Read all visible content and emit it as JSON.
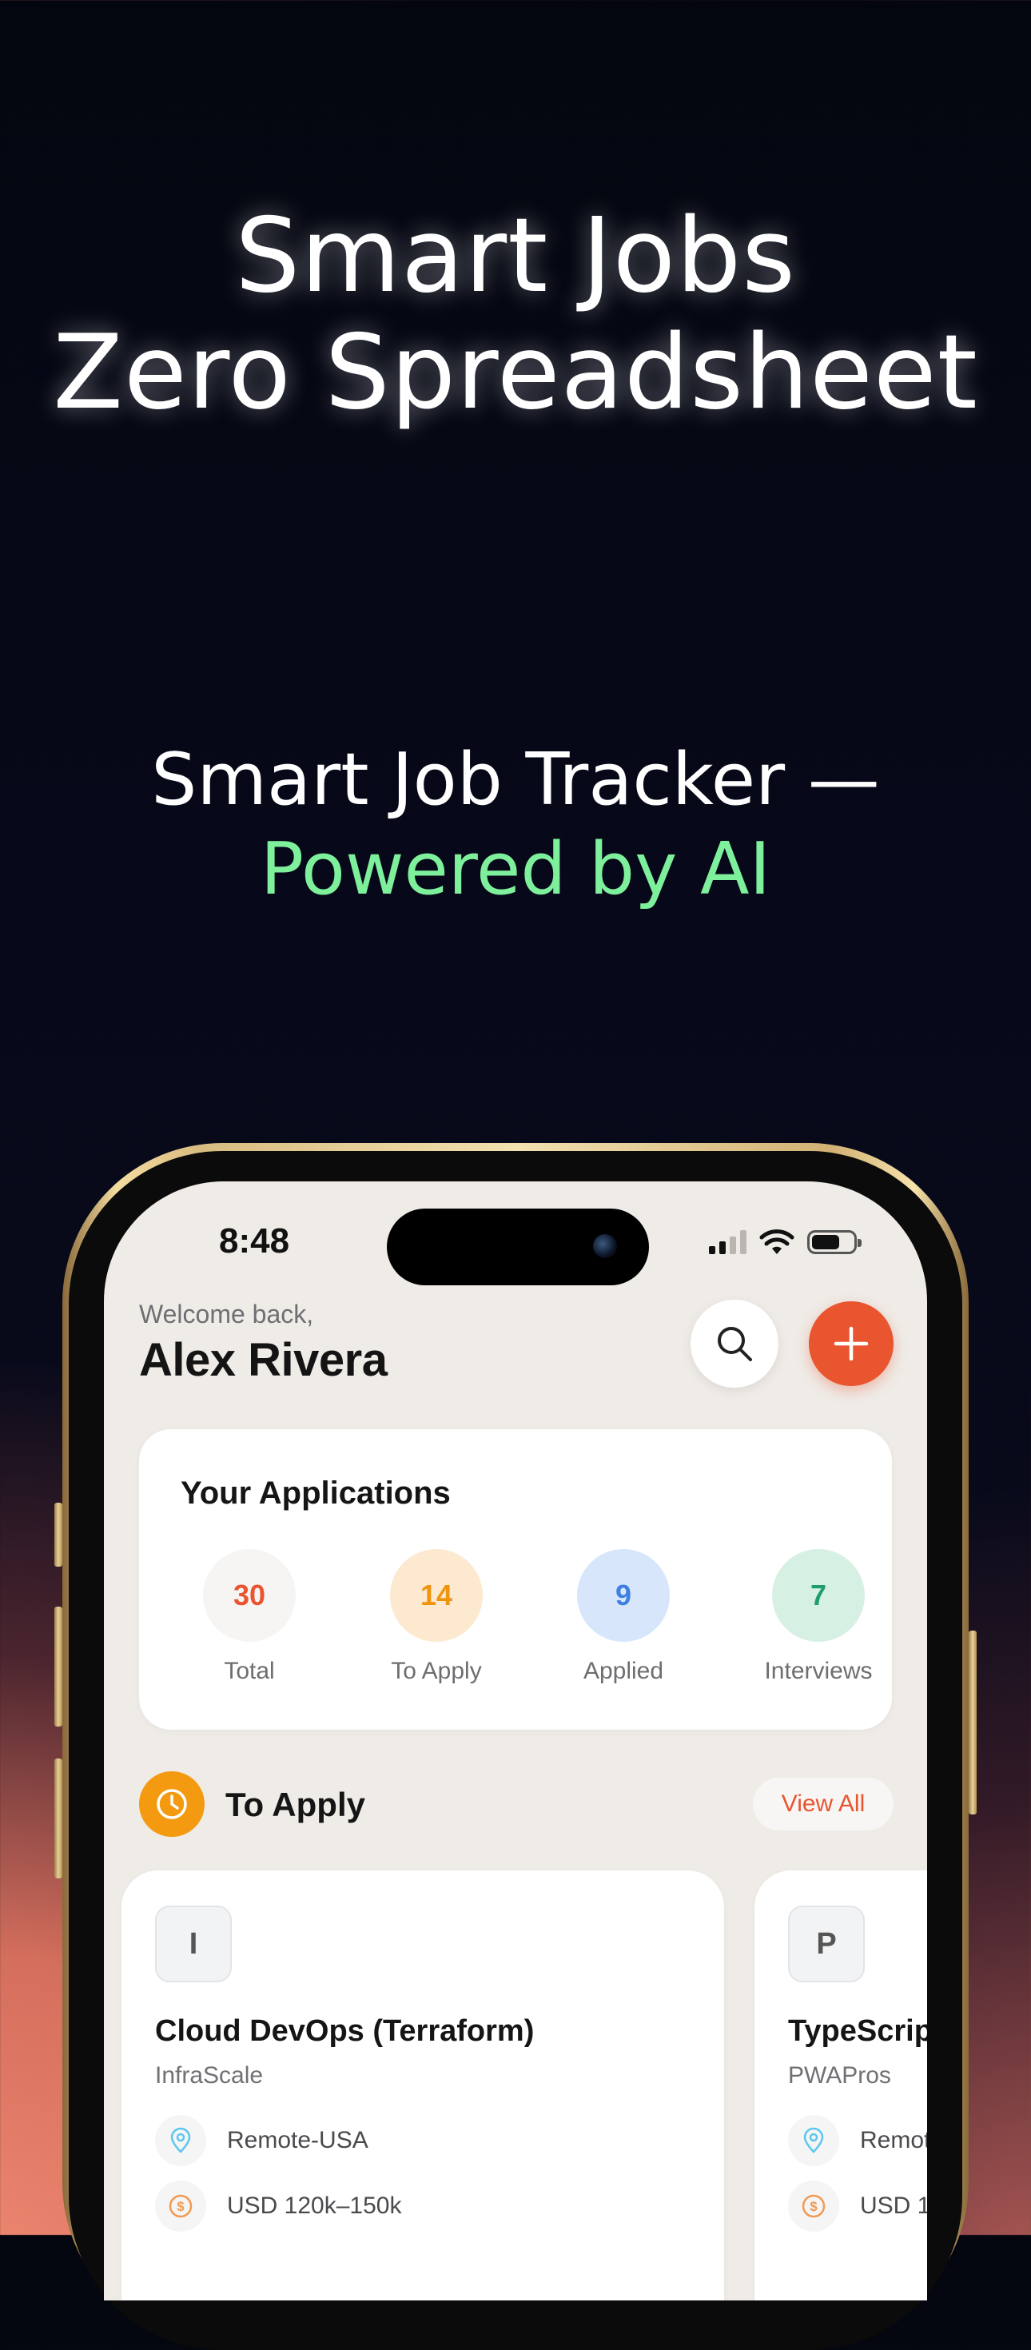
{
  "hero": {
    "line1": "Smart Jobs",
    "line2": "Zero Spreadsheet",
    "tagline": "Smart Job Tracker —",
    "tagline_accent": "Powered by AI",
    "accent_color": "#7ef09c"
  },
  "status_bar": {
    "time": "8:48",
    "icons": [
      "signal-icon",
      "wifi-icon",
      "battery-icon"
    ]
  },
  "header": {
    "welcome": "Welcome back,",
    "name": "Alex Rivera",
    "search_icon": "search-icon",
    "add_icon": "plus-icon",
    "accent_color": "#e8552f"
  },
  "applications": {
    "title": "Your Applications",
    "stats": [
      {
        "value": "30",
        "label": "Total",
        "color": "#e8552f",
        "bg": "#f7f5f3"
      },
      {
        "value": "14",
        "label": "To Apply",
        "color": "#f0940f",
        "bg": "#fde9cf"
      },
      {
        "value": "9",
        "label": "Applied",
        "color": "#3f7fe0",
        "bg": "#d8e6fb"
      },
      {
        "value": "7",
        "label": "Interviews",
        "color": "#1e9e6a",
        "bg": "#d6f1e3"
      }
    ]
  },
  "section": {
    "title": "To Apply",
    "icon": "clock-icon",
    "view_all": "View All"
  },
  "jobs": [
    {
      "logo": "I",
      "title": "Cloud DevOps (Terraform)",
      "company": "InfraScale",
      "location": "Remote-USA",
      "salary": "USD 120k–150k"
    },
    {
      "logo": "P",
      "title": "TypeScrip",
      "company": "PWAPros",
      "location": "Remot",
      "salary": "USD 1"
    }
  ]
}
